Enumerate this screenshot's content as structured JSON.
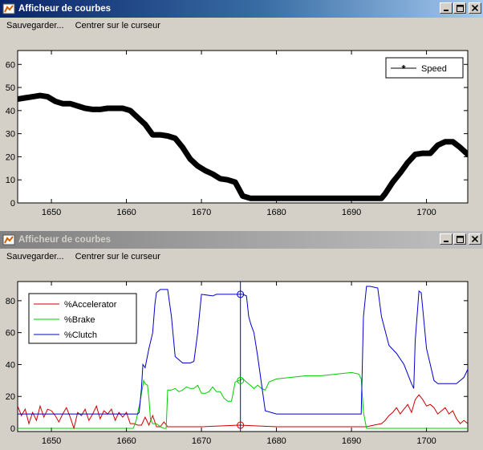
{
  "windows": [
    {
      "title": "Afficheur de courbes",
      "menu": [
        "Sauvegarder...",
        "Centrer sur le curseur"
      ]
    },
    {
      "title": "Afficheur de courbes",
      "menu": [
        "Sauvegarder...",
        "Centrer sur le curseur"
      ]
    }
  ],
  "icons": {
    "app": "matlab-figure-icon",
    "minimize": "minimize-icon",
    "maximize": "maximize-icon",
    "close": "close-icon"
  },
  "chart_data": [
    {
      "type": "line",
      "xlim": [
        1645.5,
        1705.5
      ],
      "ylim": [
        0,
        66
      ],
      "xticks": [
        1650,
        1660,
        1670,
        1680,
        1690,
        1700
      ],
      "yticks": [
        0,
        10,
        20,
        30,
        40,
        50,
        60
      ],
      "legend_position": "top-right",
      "grid": false,
      "series": [
        {
          "name": "Speed",
          "color": "#000000",
          "marker": "asterisk",
          "x": [
            1645.5,
            1646.5,
            1647.5,
            1648.5,
            1649.5,
            1650.5,
            1651.5,
            1652.5,
            1653.5,
            1654.5,
            1655.5,
            1656.5,
            1657.5,
            1658.5,
            1659.5,
            1660.5,
            1661.5,
            1662.5,
            1663.5,
            1664.5,
            1665.5,
            1666.5,
            1667.5,
            1668.5,
            1669.5,
            1670.5,
            1671.5,
            1672.5,
            1673.5,
            1674.5,
            1675.0,
            1675.5,
            1676.5,
            1680,
            1685,
            1690,
            1693,
            1694.0,
            1694.5,
            1695.5,
            1696.5,
            1697.5,
            1698.5,
            1699.5,
            1700.5,
            1701.5,
            1702.5,
            1703.5,
            1704.5,
            1705.5
          ],
          "y": [
            45,
            45.5,
            46,
            46.5,
            46,
            44,
            43,
            43,
            42,
            41,
            40.5,
            40.5,
            41,
            41,
            41,
            40,
            37,
            34,
            29.5,
            29.5,
            29,
            28,
            24,
            19,
            16,
            14,
            12.5,
            10.5,
            10,
            9,
            6,
            3,
            2,
            2,
            2,
            2,
            2,
            2,
            4,
            9,
            13,
            17.5,
            21,
            21.5,
            21.5,
            25,
            26.5,
            26.5,
            24,
            21
          ]
        }
      ]
    },
    {
      "type": "line",
      "xlim": [
        1645.5,
        1705.5
      ],
      "ylim": [
        -2,
        92
      ],
      "xticks": [
        1650,
        1660,
        1670,
        1680,
        1690,
        1700
      ],
      "yticks": [
        0,
        20,
        40,
        60,
        80
      ],
      "legend_position": "top-left",
      "grid": false,
      "cursor_x": 1675.2,
      "series": [
        {
          "name": "%Accelerator",
          "color": "#cc0000",
          "x": [
            1645.5,
            1646.0,
            1646.5,
            1647.0,
            1647.5,
            1648.0,
            1648.5,
            1649.0,
            1649.5,
            1650.0,
            1650.5,
            1651.0,
            1651.5,
            1652.0,
            1652.5,
            1653.0,
            1653.5,
            1654.0,
            1654.5,
            1655.0,
            1655.5,
            1656.0,
            1656.5,
            1657.0,
            1657.5,
            1658.0,
            1658.5,
            1659.0,
            1659.5,
            1660.0,
            1660.5,
            1661.0,
            1661.5,
            1662.0,
            1662.5,
            1663.0,
            1663.5,
            1664.0,
            1664.5,
            1665.0,
            1665.5,
            1666.0,
            1667.0,
            1670.0,
            1675.0,
            1680.0,
            1685.0,
            1690.0,
            1692.0,
            1693.0,
            1694.0,
            1694.5,
            1695.0,
            1695.5,
            1696.0,
            1696.5,
            1697.0,
            1697.5,
            1698.0,
            1698.5,
            1699.0,
            1699.5,
            1700.0,
            1700.5,
            1701.0,
            1701.5,
            1702.0,
            1702.5,
            1703.0,
            1703.5,
            1704.0,
            1704.5,
            1705.0,
            1705.5
          ],
          "y": [
            14,
            8,
            12,
            3,
            10,
            5,
            14,
            7,
            12,
            11,
            8,
            4,
            9,
            13,
            7,
            0,
            10,
            8,
            12,
            5,
            9,
            14,
            6,
            11,
            9,
            12,
            5,
            10,
            7,
            10,
            3,
            3,
            2,
            2,
            7,
            2,
            8,
            1,
            1,
            4,
            1,
            1,
            1,
            1,
            2,
            1,
            1,
            1,
            1,
            2,
            3,
            5,
            8,
            10,
            13,
            9,
            12,
            15,
            10,
            18,
            21,
            18,
            14,
            15,
            13,
            9,
            11,
            13,
            9,
            11,
            6,
            3,
            5,
            3
          ]
        },
        {
          "name": "%Brake",
          "color": "#00cc00",
          "x": [
            1645.5,
            1660.0,
            1660.9,
            1661.0,
            1661.3,
            1661.8,
            1662.0,
            1662.2,
            1662.3,
            1662.5,
            1662.8,
            1663.0,
            1663.2,
            1663.5,
            1664.0,
            1664.5,
            1665.0,
            1665.3,
            1665.5,
            1666.0,
            1666.5,
            1667.0,
            1667.5,
            1668.0,
            1668.5,
            1669.0,
            1669.5,
            1670.0,
            1670.5,
            1671.0,
            1671.5,
            1672.0,
            1672.5,
            1673.0,
            1673.5,
            1674.0,
            1674.5,
            1675.0,
            1675.5,
            1676.0,
            1676.5,
            1677.0,
            1677.5,
            1678.0,
            1678.5,
            1679.0,
            1679.5,
            1680.0,
            1682.0,
            1684.0,
            1686.0,
            1688.0,
            1690.0,
            1691.0,
            1691.3,
            1691.6,
            1692.0,
            1705.5
          ],
          "y": [
            0,
            0,
            0,
            1,
            5,
            16,
            22,
            27,
            30,
            28,
            27,
            19,
            6,
            3,
            3,
            1,
            0,
            0,
            24,
            24,
            25,
            23,
            24,
            26,
            25,
            25,
            27,
            22,
            22,
            23,
            26,
            23,
            23,
            19,
            17,
            17,
            29,
            30,
            31,
            29,
            27,
            25,
            27,
            25,
            24,
            29,
            30,
            31,
            32,
            33,
            33,
            34,
            35,
            34,
            31,
            10,
            0,
            0
          ]
        },
        {
          "name": "%Clutch",
          "color": "#0000cc",
          "x": [
            1645.5,
            1661.5,
            1661.7,
            1662.0,
            1662.2,
            1662.5,
            1663.0,
            1663.5,
            1663.8,
            1664.0,
            1664.5,
            1665.5,
            1666.0,
            1666.5,
            1667.5,
            1668.5,
            1669.0,
            1669.5,
            1670.0,
            1671.5,
            1672.0,
            1675.5,
            1676.0,
            1676.3,
            1676.6,
            1677.0,
            1677.5,
            1678.5,
            1680.0,
            1682.0,
            1684.0,
            1686.0,
            1688.0,
            1690.0,
            1691.3,
            1691.6,
            1692.0,
            1692.5,
            1693.5,
            1694.0,
            1695.0,
            1696.0,
            1697.0,
            1698.0,
            1698.3,
            1698.5,
            1699.0,
            1699.3,
            1699.5,
            1700.0,
            1700.5,
            1701.0,
            1701.5,
            1702.0,
            1703.0,
            1704.0,
            1705.0,
            1705.5
          ],
          "y": [
            9,
            9,
            10,
            25,
            40,
            38,
            50,
            60,
            78,
            85,
            87,
            87,
            70,
            45,
            41,
            41,
            42,
            60,
            84,
            83,
            84,
            84,
            83,
            70,
            65,
            60,
            45,
            11,
            9,
            9,
            9,
            9,
            9,
            9,
            9,
            70,
            89,
            89,
            88,
            70,
            52,
            47,
            40,
            28,
            25,
            55,
            86,
            85,
            75,
            50,
            40,
            30,
            28,
            28,
            28,
            28,
            32,
            37
          ]
        }
      ]
    }
  ]
}
